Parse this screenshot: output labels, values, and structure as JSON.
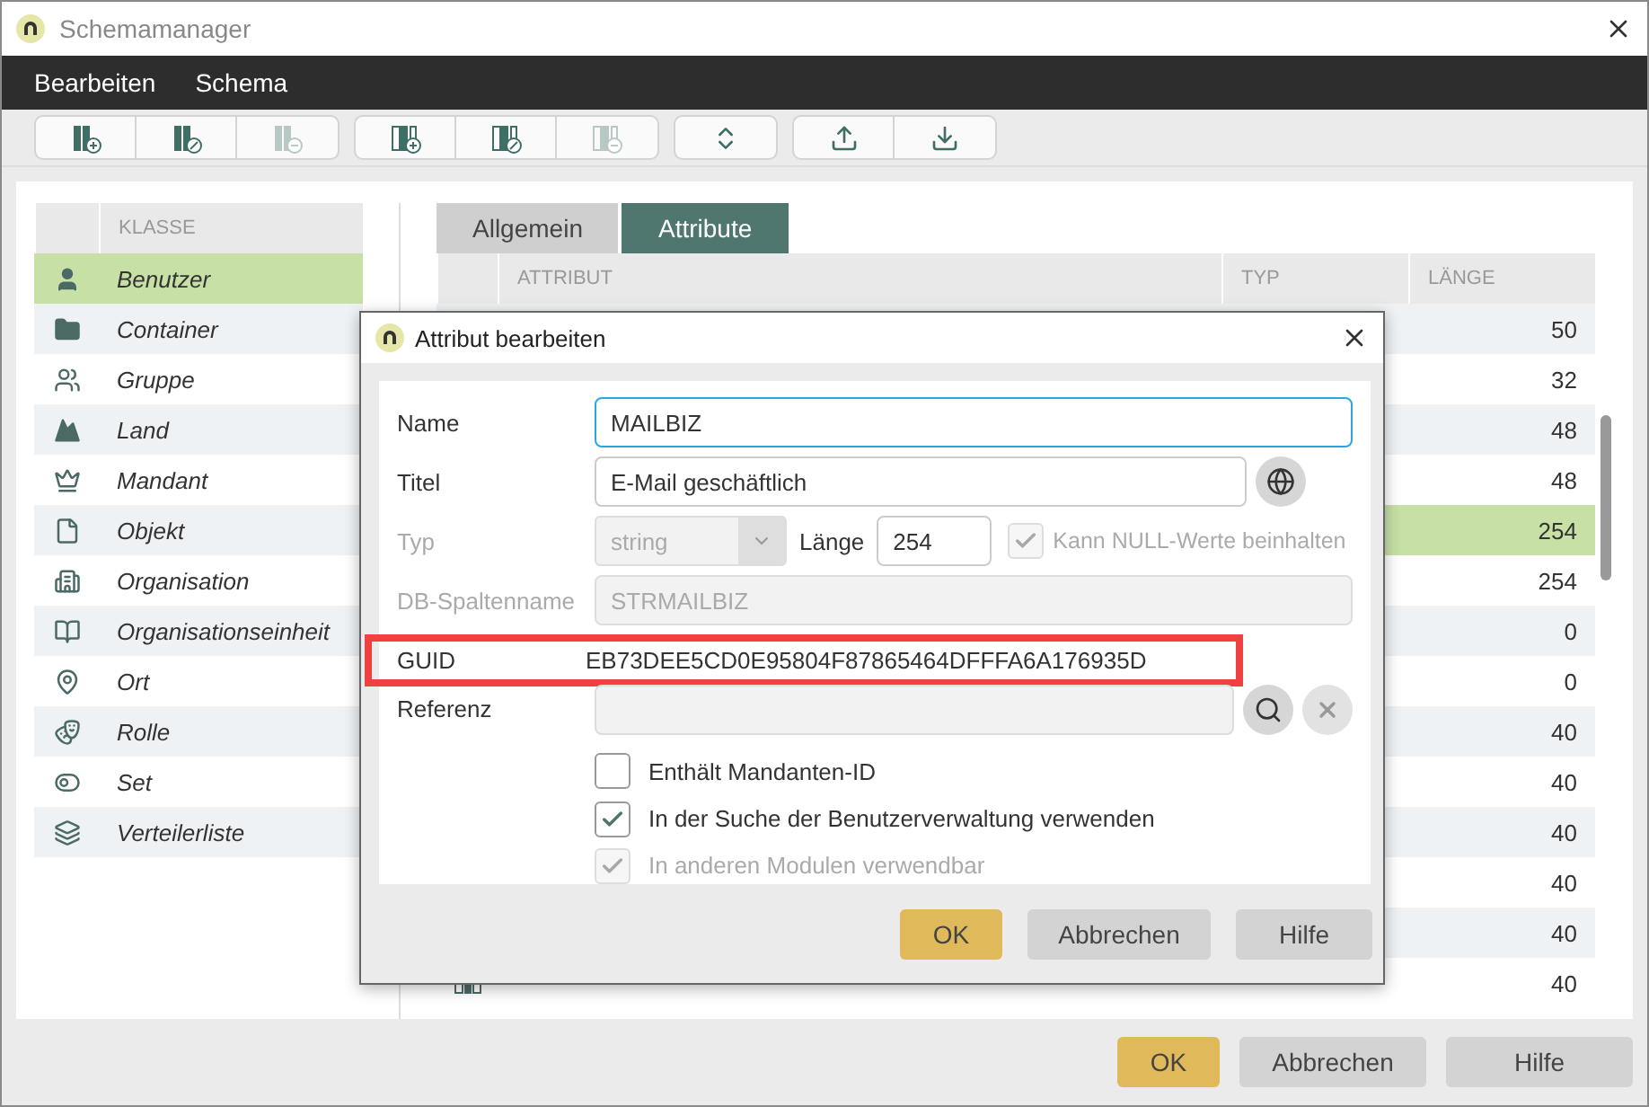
{
  "window": {
    "title": "Schemamanager"
  },
  "menu": [
    {
      "label": "Bearbeiten"
    },
    {
      "label": "Schema"
    }
  ],
  "toolbar": [
    [
      {
        "kind": "class-add",
        "disabled": false
      },
      {
        "kind": "class-edit",
        "disabled": false
      },
      {
        "kind": "class-remove",
        "disabled": true
      }
    ],
    [
      {
        "kind": "attr-add",
        "disabled": false
      },
      {
        "kind": "attr-edit",
        "disabled": false
      },
      {
        "kind": "attr-remove",
        "disabled": true
      }
    ],
    [
      {
        "kind": "sort",
        "disabled": false
      }
    ],
    [
      {
        "kind": "upload",
        "disabled": false
      },
      {
        "kind": "download",
        "disabled": false
      }
    ]
  ],
  "classes": {
    "header": "KLASSE",
    "items": [
      {
        "label": "Benutzer",
        "kind": "user",
        "selected": true
      },
      {
        "label": "Container",
        "kind": "folder",
        "selected": false
      },
      {
        "label": "Gruppe",
        "kind": "group",
        "selected": false
      },
      {
        "label": "Land",
        "kind": "land",
        "selected": false
      },
      {
        "label": "Mandant",
        "kind": "crown",
        "selected": false
      },
      {
        "label": "Objekt",
        "kind": "file",
        "selected": false
      },
      {
        "label": "Organisation",
        "kind": "building",
        "selected": false
      },
      {
        "label": "Organisationseinheit",
        "kind": "book",
        "selected": false
      },
      {
        "label": "Ort",
        "kind": "pin",
        "selected": false
      },
      {
        "label": "Rolle",
        "kind": "masks",
        "selected": false
      },
      {
        "label": "Set",
        "kind": "toggle",
        "selected": false
      },
      {
        "label": "Verteilerliste",
        "kind": "layers",
        "selected": false
      }
    ]
  },
  "tabs": [
    {
      "label": "Allgemein",
      "selected": false
    },
    {
      "label": "Attribute",
      "selected": true
    }
  ],
  "table": {
    "columns": [
      "ATTRIBUT",
      "TYP",
      "LÄNGE"
    ],
    "rows": [
      {
        "length": "50",
        "selected": false
      },
      {
        "length": "32",
        "selected": false
      },
      {
        "length": "48",
        "selected": false
      },
      {
        "length": "48",
        "selected": false
      },
      {
        "length": "254",
        "selected": true
      },
      {
        "length": "254",
        "selected": false
      },
      {
        "length": "0",
        "selected": false
      },
      {
        "length": "0",
        "selected": false
      },
      {
        "length": "40",
        "selected": false
      },
      {
        "length": "40",
        "selected": false
      },
      {
        "length": "40",
        "selected": false
      },
      {
        "length": "40",
        "selected": false
      },
      {
        "length": "40",
        "selected": false
      },
      {
        "has_icon": true,
        "length": "40",
        "selected": false
      }
    ]
  },
  "buttons": [
    {
      "label": "OK",
      "kind": "primary"
    },
    {
      "label": "Abbrechen",
      "kind": "normal"
    },
    {
      "label": "Hilfe",
      "kind": "normal"
    }
  ],
  "dialog": {
    "title": "Attribut bearbeiten",
    "name": {
      "label": "Name",
      "value": "MAILBIZ"
    },
    "titel": {
      "label": "Titel",
      "value": "E-Mail geschäftlich"
    },
    "typ": {
      "label": "Typ",
      "value": "string",
      "disabled": true
    },
    "laenge": {
      "label": "Länge",
      "value": "254"
    },
    "nullable": {
      "label": "Kann NULL-Werte beinhalten",
      "checked": true,
      "disabled": true
    },
    "db_column": {
      "label": "DB-Spaltenname",
      "value": "STRMAILBIZ",
      "disabled": true
    },
    "guid": {
      "label": "GUID",
      "value": "EB73DEE5CD0E95804F87865464DFFFA6A176935D",
      "highlighted": true
    },
    "referenz": {
      "label": "Referenz"
    },
    "options": [
      {
        "label": "Enthält Mandanten-ID",
        "checked": false,
        "disabled": false
      },
      {
        "label": "In der Suche der Benutzerverwaltung verwenden",
        "checked": true,
        "disabled": false
      },
      {
        "label": "In anderen Modulen verwendbar",
        "checked": true,
        "disabled": true
      }
    ],
    "buttons": [
      {
        "label": "OK",
        "kind": "primary"
      },
      {
        "label": "Abbrechen",
        "kind": "normal"
      },
      {
        "label": "Hilfe",
        "kind": "normal"
      }
    ]
  }
}
